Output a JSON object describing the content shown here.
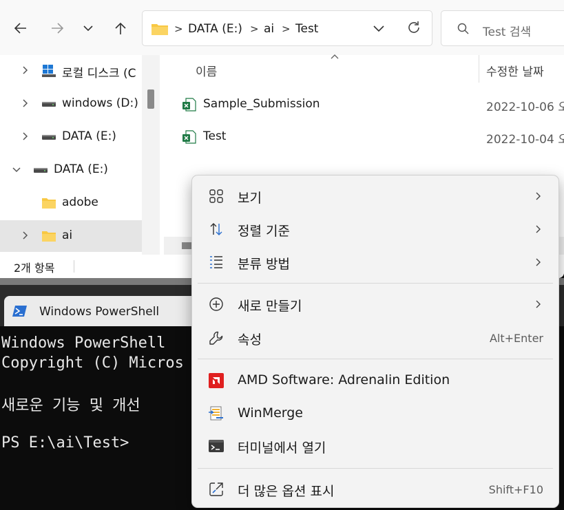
{
  "explorer": {
    "address": {
      "crumbs": [
        "DATA (E:)",
        "ai",
        "Test"
      ],
      "separator": ">"
    },
    "search": {
      "placeholder": "Test 검색"
    },
    "tree": [
      {
        "label": "로컬 디스크 (C",
        "icon": "windows-drive-icon",
        "expanded": false,
        "selected": false
      },
      {
        "label": "windows (D:)",
        "icon": "drive-icon",
        "expanded": false,
        "selected": false
      },
      {
        "label": "DATA (E:)",
        "icon": "drive-icon",
        "expanded": false,
        "selected": false
      },
      {
        "label": "DATA (E:)",
        "icon": "drive-icon",
        "expanded": true,
        "selected": false
      },
      {
        "label": "adobe",
        "icon": "folder-icon",
        "expanded": false,
        "selected": false
      },
      {
        "label": "ai",
        "icon": "folder-icon",
        "expanded": false,
        "selected": true
      }
    ],
    "columns": {
      "name": "이름",
      "modified": "수정한 날짜"
    },
    "files": [
      {
        "name": "Sample_Submission",
        "icon": "excel-file-icon",
        "modified": "2022-10-06 오"
      },
      {
        "name": "Test",
        "icon": "excel-file-icon",
        "modified": "2022-10-04 오"
      }
    ],
    "status": {
      "item_count": "2개 항목"
    }
  },
  "powershell": {
    "tab_title": "Windows PowerShell",
    "lines": [
      "Windows PowerShell",
      "Copyright (C) Micros",
      "",
      "새로운 기능 및 개선",
      "",
      "PS E:\\ai\\Test>"
    ]
  },
  "context_menu": {
    "items": [
      {
        "label": "보기",
        "icon": "grid-view-icon",
        "submenu": true
      },
      {
        "label": "정렬 기준",
        "icon": "sort-icon",
        "submenu": true
      },
      {
        "label": "분류 방법",
        "icon": "group-by-icon",
        "submenu": true
      },
      {
        "label": "새로 만들기",
        "icon": "plus-circle-icon",
        "submenu": true
      },
      {
        "label": "속성",
        "icon": "wrench-icon",
        "shortcut": "Alt+Enter"
      },
      {
        "label": "AMD Software: Adrenalin Edition",
        "icon": "amd-icon"
      },
      {
        "label": "WinMerge",
        "icon": "winmerge-icon"
      },
      {
        "label": "터미널에서 열기",
        "icon": "terminal-icon"
      },
      {
        "label": "더 많은 옵션 표시",
        "icon": "more-options-icon",
        "shortcut": "Shift+F10"
      }
    ]
  },
  "colors": {
    "menu_background": "#f3f3f3",
    "selection": "#e5e5e5",
    "excel_green": "#1f7a45",
    "folder_yellow": "#f8c843",
    "amd_red": "#e02020",
    "console_background": "#0c0c0c"
  }
}
